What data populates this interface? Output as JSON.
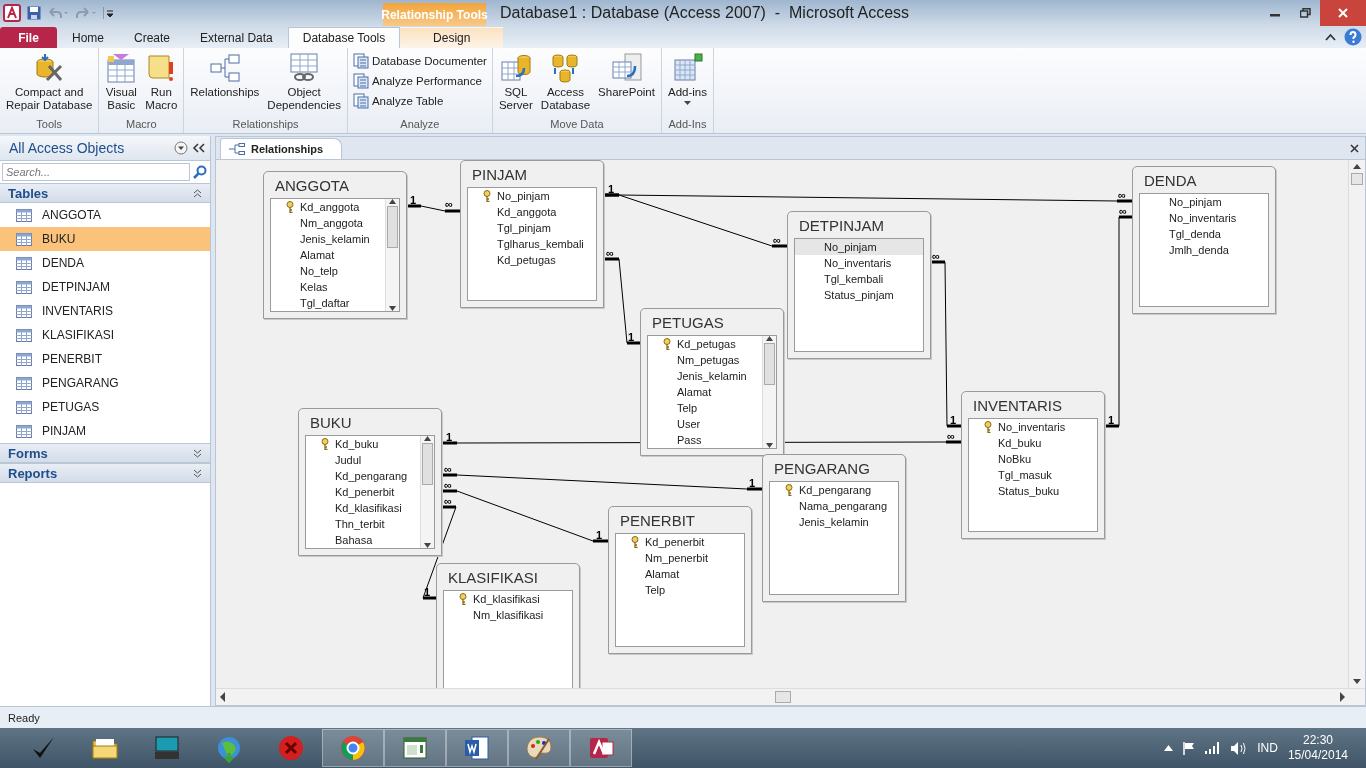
{
  "window": {
    "title": "Database1 : Database (Access 2007)  -  Microsoft Access",
    "contextual_group": "Relationship Tools"
  },
  "ribbon_tabs": [
    {
      "label": "File",
      "kind": "file",
      "selected": false
    },
    {
      "label": "Home",
      "kind": "normal",
      "selected": false
    },
    {
      "label": "Create",
      "kind": "normal",
      "selected": false
    },
    {
      "label": "External Data",
      "kind": "normal",
      "selected": false
    },
    {
      "label": "Database Tools",
      "kind": "normal",
      "selected": true
    },
    {
      "label": "Design",
      "kind": "contextual",
      "selected": false
    }
  ],
  "ribbon_groups": [
    {
      "label": "Tools",
      "buttons": [
        {
          "label": "Compact and\nRepair Database",
          "kind": "large"
        }
      ]
    },
    {
      "label": "Macro",
      "buttons": [
        {
          "label": "Visual\nBasic",
          "kind": "large"
        },
        {
          "label": "Run\nMacro",
          "kind": "large"
        }
      ]
    },
    {
      "label": "Relationships",
      "buttons": [
        {
          "label": "Relationships",
          "kind": "large"
        },
        {
          "label": "Object\nDependencies",
          "kind": "large"
        }
      ]
    },
    {
      "label": "Analyze",
      "buttons": [
        {
          "label": "Database Documenter",
          "kind": "small"
        },
        {
          "label": "Analyze Performance",
          "kind": "small"
        },
        {
          "label": "Analyze Table",
          "kind": "small"
        }
      ]
    },
    {
      "label": "Move Data",
      "buttons": [
        {
          "label": "SQL\nServer",
          "kind": "large"
        },
        {
          "label": "Access\nDatabase",
          "kind": "large"
        },
        {
          "label": "SharePoint",
          "kind": "large"
        }
      ]
    },
    {
      "label": "Add-Ins",
      "buttons": [
        {
          "label": "Add-ins",
          "kind": "dropdown"
        }
      ]
    }
  ],
  "nav_pane": {
    "title": "All Access Objects",
    "search": {
      "placeholder": "Search..."
    },
    "sections": [
      {
        "label": "Tables",
        "expanded": true,
        "items": [
          {
            "label": "ANGGOTA",
            "selected": false
          },
          {
            "label": "BUKU",
            "selected": true
          },
          {
            "label": "DENDA",
            "selected": false
          },
          {
            "label": "DETPINJAM",
            "selected": false
          },
          {
            "label": "INVENTARIS",
            "selected": false
          },
          {
            "label": "KLASIFIKASI",
            "selected": false
          },
          {
            "label": "PENERBIT",
            "selected": false
          },
          {
            "label": "PENGARANG",
            "selected": false
          },
          {
            "label": "PETUGAS",
            "selected": false
          },
          {
            "label": "PINJAM",
            "selected": false
          }
        ]
      },
      {
        "label": "Forms",
        "expanded": false
      },
      {
        "label": "Reports",
        "expanded": false
      }
    ]
  },
  "document_tab": {
    "label": "Relationships",
    "selected": true
  },
  "tables": [
    {
      "name": "ANGGOTA",
      "fields": [
        {
          "name": "Kd_anggota",
          "key": true,
          "selected": false
        },
        {
          "name": "Nm_anggota",
          "key": false,
          "selected": false
        },
        {
          "name": "Jenis_kelamin",
          "key": false,
          "selected": false
        },
        {
          "name": "Alamat",
          "key": false,
          "selected": false
        },
        {
          "name": "No_telp",
          "key": false,
          "selected": false
        },
        {
          "name": "Kelas",
          "key": false,
          "selected": false
        },
        {
          "name": "Tgl_daftar",
          "key": false,
          "selected": false
        }
      ]
    },
    {
      "name": "PINJAM",
      "fields": [
        {
          "name": "No_pinjam",
          "key": true,
          "selected": false
        },
        {
          "name": "Kd_anggota",
          "key": false,
          "selected": false
        },
        {
          "name": "Tgl_pinjam",
          "key": false,
          "selected": false
        },
        {
          "name": "Tglharus_kembali",
          "key": false,
          "selected": false
        },
        {
          "name": "Kd_petugas",
          "key": false,
          "selected": false
        }
      ]
    },
    {
      "name": "DETPINJAM",
      "fields": [
        {
          "name": "No_pinjam",
          "key": false,
          "selected": true
        },
        {
          "name": "No_inventaris",
          "key": false,
          "selected": false
        },
        {
          "name": "Tgl_kembali",
          "key": false,
          "selected": false
        },
        {
          "name": "Status_pinjam",
          "key": false,
          "selected": false
        }
      ]
    },
    {
      "name": "DENDA",
      "fields": [
        {
          "name": "No_pinjam",
          "key": false,
          "selected": false
        },
        {
          "name": "No_inventaris",
          "key": false,
          "selected": false
        },
        {
          "name": "Tgl_denda",
          "key": false,
          "selected": false
        },
        {
          "name": "Jmlh_denda",
          "key": false,
          "selected": false
        }
      ]
    },
    {
      "name": "PETUGAS",
      "fields": [
        {
          "name": "Kd_petugas",
          "key": true,
          "selected": false
        },
        {
          "name": "Nm_petugas",
          "key": false,
          "selected": false
        },
        {
          "name": "Jenis_kelamin",
          "key": false,
          "selected": false
        },
        {
          "name": "Alamat",
          "key": false,
          "selected": false
        },
        {
          "name": "Telp",
          "key": false,
          "selected": false
        },
        {
          "name": "User",
          "key": false,
          "selected": false
        },
        {
          "name": "Pass",
          "key": false,
          "selected": false
        }
      ]
    },
    {
      "name": "INVENTARIS",
      "fields": [
        {
          "name": "No_inventaris",
          "key": true,
          "selected": false
        },
        {
          "name": "Kd_buku",
          "key": false,
          "selected": false
        },
        {
          "name": "NoBku",
          "key": false,
          "selected": false
        },
        {
          "name": "Tgl_masuk",
          "key": false,
          "selected": false
        },
        {
          "name": "Status_buku",
          "key": false,
          "selected": false
        }
      ]
    },
    {
      "name": "BUKU",
      "fields": [
        {
          "name": "Kd_buku",
          "key": true,
          "selected": false
        },
        {
          "name": "Judul",
          "key": false,
          "selected": false
        },
        {
          "name": "Kd_pengarang",
          "key": false,
          "selected": false
        },
        {
          "name": "Kd_penerbit",
          "key": false,
          "selected": false
        },
        {
          "name": "Kd_klasifikasi",
          "key": false,
          "selected": false
        },
        {
          "name": "Thn_terbit",
          "key": false,
          "selected": false
        },
        {
          "name": "Bahasa",
          "key": false,
          "selected": false
        }
      ]
    },
    {
      "name": "PENGARANG",
      "fields": [
        {
          "name": "Kd_pengarang",
          "key": true,
          "selected": false
        },
        {
          "name": "Nama_pengarang",
          "key": false,
          "selected": false
        },
        {
          "name": "Jenis_kelamin",
          "key": false,
          "selected": false
        }
      ]
    },
    {
      "name": "PENERBIT",
      "fields": [
        {
          "name": "Kd_penerbit",
          "key": true,
          "selected": false
        },
        {
          "name": "Nm_penerbit",
          "key": false,
          "selected": false
        },
        {
          "name": "Alamat",
          "key": false,
          "selected": false
        },
        {
          "name": "Telp",
          "key": false,
          "selected": false
        }
      ]
    },
    {
      "name": "KLASIFIKASI",
      "fields": [
        {
          "name": "Kd_klasifikasi",
          "key": true,
          "selected": false
        },
        {
          "name": "Nm_klasifikasi",
          "key": false,
          "selected": false
        }
      ]
    }
  ],
  "relationships": [
    {
      "from_label": "1",
      "to_label": "∞"
    },
    {
      "from_label": "1",
      "to_label": "∞"
    },
    {
      "to_label": "∞"
    },
    {
      "from_label": "∞",
      "to_label": "1"
    },
    {
      "from_label": "∞",
      "to_label": "1"
    },
    {
      "from_label": "∞",
      "to_label": "1"
    },
    {
      "from_label": "1",
      "to_label": "∞"
    },
    {
      "from_label": "∞",
      "to_label": "1"
    },
    {
      "from_label": "∞",
      "to_label": "1"
    },
    {
      "from_label": "∞",
      "to_label": "1"
    }
  ],
  "status_bar": {
    "text": "Ready"
  },
  "taskbar": {
    "apps": [
      {
        "running": false
      },
      {
        "running": false
      },
      {
        "running": false
      },
      {
        "running": false
      },
      {
        "running": false
      },
      {
        "running": true
      },
      {
        "running": true
      },
      {
        "running": true
      },
      {
        "running": true
      },
      {
        "running": true
      }
    ],
    "language": "IND",
    "time": "22:30",
    "date": "15/04/2014"
  }
}
